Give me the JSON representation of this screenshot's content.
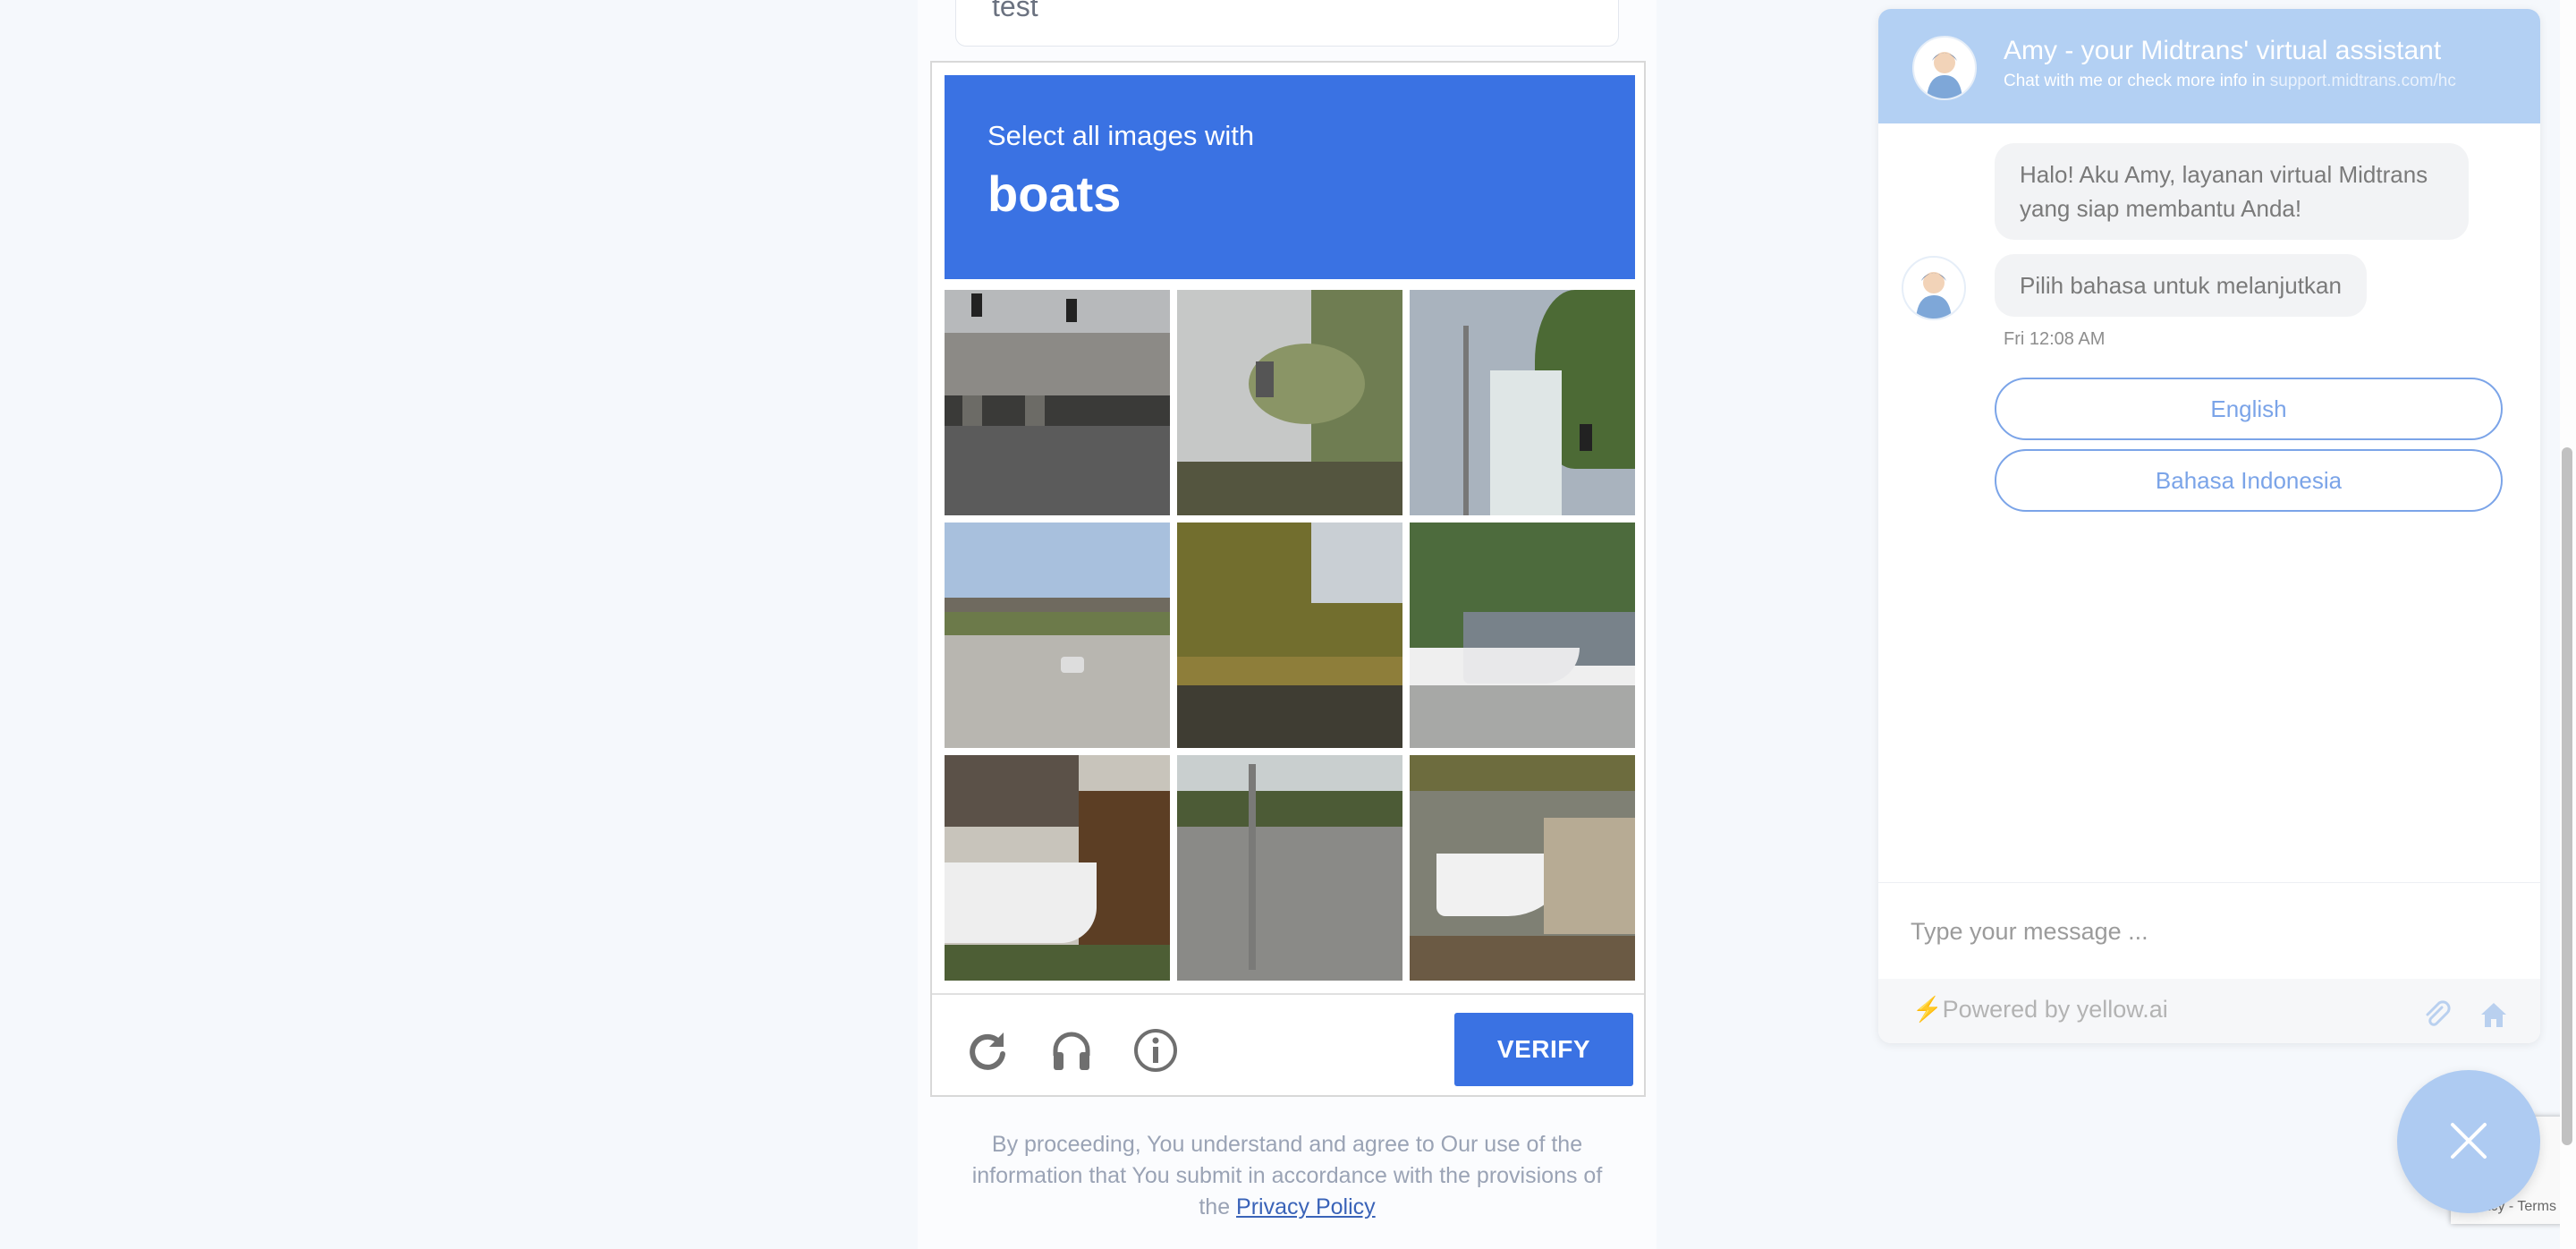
{
  "form": {
    "test_value": "test"
  },
  "captcha": {
    "instruction": "Select all images with",
    "target_object": "boats",
    "tiles": [
      "tile-overpass-traffic-lights",
      "tile-palm-tree-building",
      "tile-street-sign-building",
      "tile-highway-bridge",
      "tile-tree-lined-road",
      "tile-marina-boat-parking",
      "tile-boat-by-house",
      "tile-street-crossing",
      "tile-docked-boats"
    ],
    "controls": {
      "reload_icon": "reload-icon",
      "audio_icon": "headphones-icon",
      "info_icon": "info-icon",
      "verify_label": "VERIFY"
    }
  },
  "disclaimer": {
    "text": "By proceeding, You understand and agree to Our use of the information that You submit in accordance with the provisions of the ",
    "link_label": "Privacy Policy"
  },
  "chat": {
    "title": "Amy - your Midtrans' virtual assistant",
    "subtitle": "Chat with me or check more info in ",
    "subtitle_link": "support.midtrans.com/hc",
    "messages": [
      "Halo! Aku Amy, layanan virtual Midtrans yang siap membantu Anda!",
      "Pilih bahasa untuk melanjutkan"
    ],
    "timestamp": "Fri 12:08 AM",
    "options": [
      "English",
      "Bahasa Indonesia"
    ],
    "input_placeholder": "Type your message ...",
    "powered_bolt": "⚡",
    "powered_by": "Powered by yellow.ai",
    "icons": [
      "paperclip-icon",
      "home-icon",
      "close-icon"
    ]
  },
  "recaptcha": {
    "terms": "Privacy - Terms"
  },
  "colors": {
    "captcha_blue": "#3a72e3",
    "chat_header": "#b3d0f3",
    "option_border": "#7ba4e8",
    "page_bg": "#f5f8fc"
  }
}
